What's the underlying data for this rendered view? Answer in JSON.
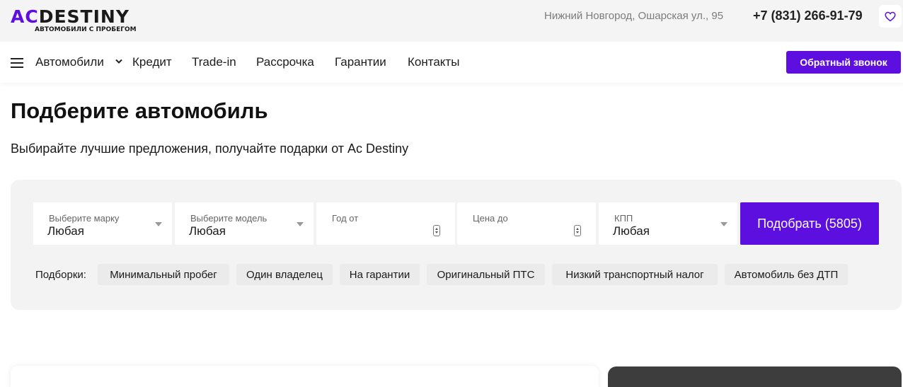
{
  "header": {
    "logo": {
      "accent": "AC",
      "name": "DESTINY",
      "tagline": "АВТОМОБИЛИ С ПРОБЕГОМ"
    },
    "address": "Нижний Новгород, Ошарская ул., 95",
    "phone": "+7 (831) 266-91-79",
    "favorites_icon": "heart-icon"
  },
  "nav": {
    "menu_icon": "burger-menu-icon",
    "items": [
      "Автомобили",
      "Кредит",
      "Trade-in",
      "Рассрочка",
      "Гарантии",
      "Контакты"
    ],
    "callback_label": "Обратный звонок"
  },
  "main": {
    "title": "Подберите автомобиль",
    "subtitle": "Выбирайте лучшие предложения, получайте подарки от Ac Destiny"
  },
  "filter": {
    "fields": [
      {
        "label": "Выберите марку",
        "value": "Любая",
        "kind": "select"
      },
      {
        "label": "Выберите модель",
        "value": "Любая",
        "kind": "select"
      },
      {
        "label": "Год от",
        "value": "",
        "kind": "number"
      },
      {
        "label": "Цена до",
        "value": "",
        "kind": "number"
      },
      {
        "label": "КПП",
        "value": "Любая",
        "kind": "select"
      }
    ],
    "submit_label": "Подобрать (5805)",
    "collections_label": "Подборки:",
    "collections": [
      "Минимальный пробег",
      "Один владелец",
      "На гарантии",
      "Оригинальный ПТС",
      "Низкий транспортный налог",
      "Автомобиль без ДТП"
    ]
  },
  "colors": {
    "accent": "#5d0fe0",
    "topbar_bg": "#f4f4f4",
    "panel_bg": "#f3f3f3",
    "chip_bg": "#ebebeb",
    "dark_card": "#3d3d3d"
  }
}
